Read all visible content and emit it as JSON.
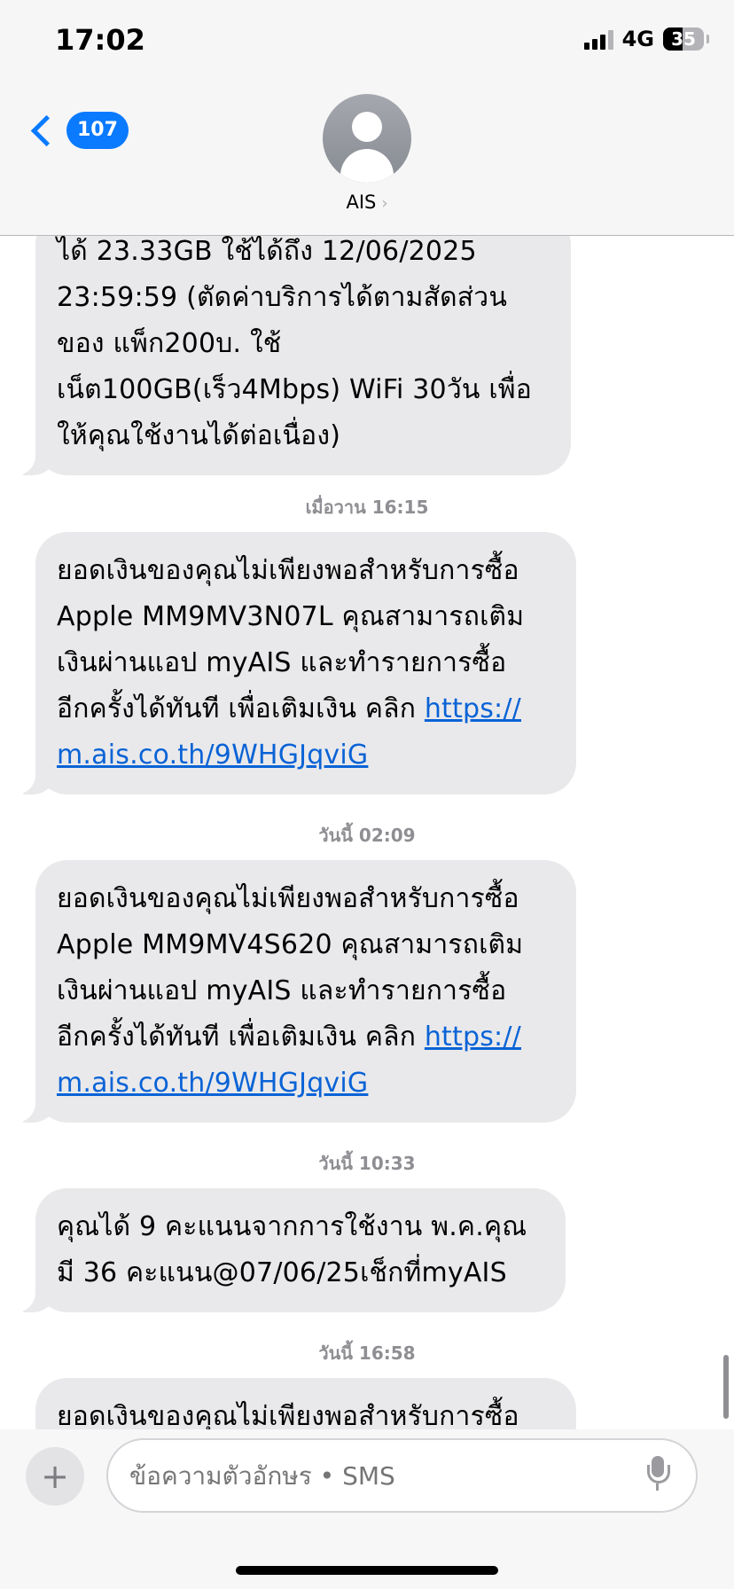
{
  "status_bar": {
    "time": "17:02",
    "network": "4G",
    "battery": "35"
  },
  "header": {
    "back_count": "107",
    "contact": "AIS",
    "contact_arrow": "›"
  },
  "conversation": [
    {
      "type": "message",
      "lines": [
        "ได้ 23.33GB ใช้ได้ถึง 12/06/2025",
        "23:59:59 (ตัดค่าบริการได้ตามสัดส่วน",
        "ของ แพ็ก200บ. ใช้",
        "เน็ต100GB(เร็ว4Mbps) WiFi 30วัน เพื่อ",
        "ให้คุณใช้งานได้ต่อเนื่อง)"
      ]
    },
    {
      "type": "timestamp",
      "text": "เมื่อวาน 16:15"
    },
    {
      "type": "message",
      "lines": [
        "ยอดเงินของคุณไม่เพียงพอสำหรับการซื้อ",
        "Apple MM9MV3N07L คุณสามารถเติม",
        "เงินผ่านแอป myAIS และทำรายการซื้อ",
        "อีกครั้งได้ทันที เพื่อเติมเงิน คลิก "
      ],
      "link_a": "https://",
      "link_b": "m.ais.co.th/9WHGJqviG"
    },
    {
      "type": "timestamp",
      "text": "วันนี้ 02:09"
    },
    {
      "type": "message",
      "lines": [
        "ยอดเงินของคุณไม่เพียงพอสำหรับการซื้อ",
        "Apple MM9MV4S620 คุณสามารถเติม",
        "เงินผ่านแอป myAIS และทำรายการซื้อ",
        "อีกครั้งได้ทันที เพื่อเติมเงิน คลิก "
      ],
      "link_a": "https://",
      "link_b": "m.ais.co.th/9WHGJqviG"
    },
    {
      "type": "timestamp",
      "text": "วันนี้ 10:33"
    },
    {
      "type": "message",
      "lines": [
        "คุณได้ 9 คะแนนจากการใช้งาน พ.ค.คุณ",
        "มี 36 คะแนน@07/06/25เช็กที่myAIS"
      ]
    },
    {
      "type": "timestamp",
      "text": "วันนี้ 16:58"
    },
    {
      "type": "message",
      "lines": [
        "ยอดเงินของคุณไม่เพียงพอสำหรับการซื้อ"
      ]
    }
  ],
  "composer": {
    "placeholder": "ข้อความตัวอักษร • SMS",
    "plus": "+"
  }
}
